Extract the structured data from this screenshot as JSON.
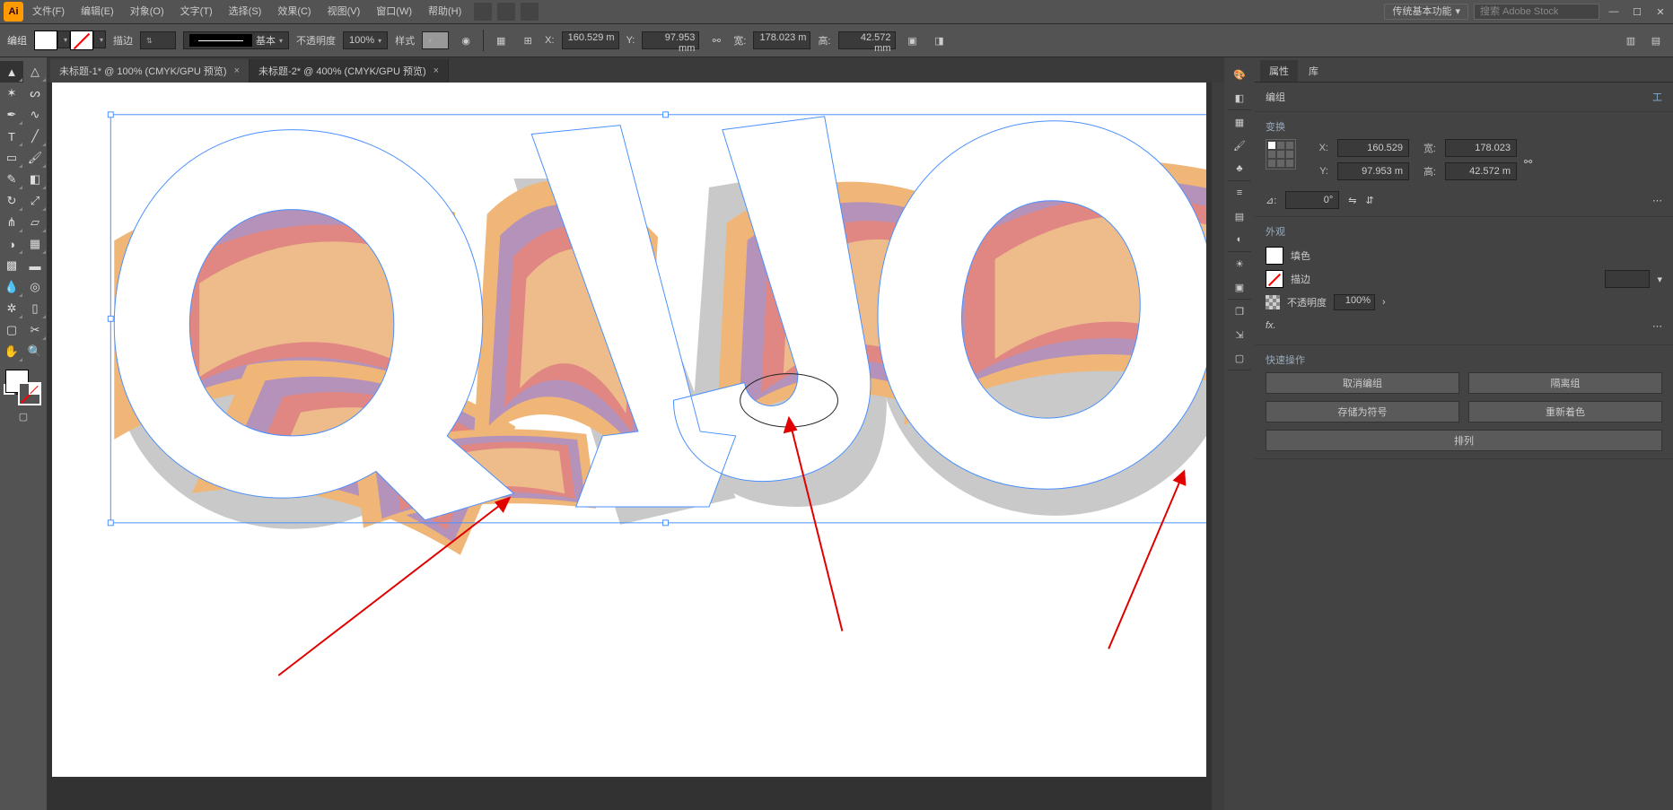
{
  "menu": {
    "items": [
      "文件(F)",
      "编辑(E)",
      "对象(O)",
      "文字(T)",
      "选择(S)",
      "效果(C)",
      "视图(V)",
      "窗口(W)",
      "帮助(H)"
    ],
    "workspace": "传统基本功能",
    "search_placeholder": "搜索 Adobe Stock"
  },
  "control": {
    "selection_label": "编组",
    "stroke_label": "描边",
    "stroke_dd": "基本",
    "opacity_label": "不透明度",
    "opacity_value": "100%",
    "style_label": "样式",
    "x_label": "X:",
    "x_value": "160.529 m",
    "y_label": "Y:",
    "y_value": "97.953 mm",
    "w_label": "宽:",
    "w_value": "178.023 m",
    "h_label": "高:",
    "h_value": "42.572 mm"
  },
  "tabs": {
    "items": [
      {
        "label": "未标题-1* @ 100% (CMYK/GPU 预览)",
        "active": false
      },
      {
        "label": "未标题-2* @ 400% (CMYK/GPU 预览)",
        "active": true
      }
    ]
  },
  "panel": {
    "tabs": [
      "属性",
      "库"
    ],
    "object_type": "编组",
    "tool_link": "工",
    "transform": {
      "title": "变换",
      "x": "160.529",
      "w": "178.023",
      "y": "97.953 m",
      "h": "42.572 m",
      "xl": "X:",
      "yl": "Y:",
      "wl": "宽:",
      "hl": "高:",
      "angle_label": "⊿:",
      "angle": "0°"
    },
    "appearance": {
      "title": "外观",
      "fill_label": "填色",
      "stroke_label": "描边",
      "opacity_label": "不透明度",
      "opacity_value": "100%",
      "fx": "fx."
    },
    "quick": {
      "title": "快速操作",
      "btn1": "取消编组",
      "btn2": "隔离组",
      "btn3": "存储为符号",
      "btn4": "重新着色",
      "btn5": "排列"
    }
  },
  "chart_data": null
}
